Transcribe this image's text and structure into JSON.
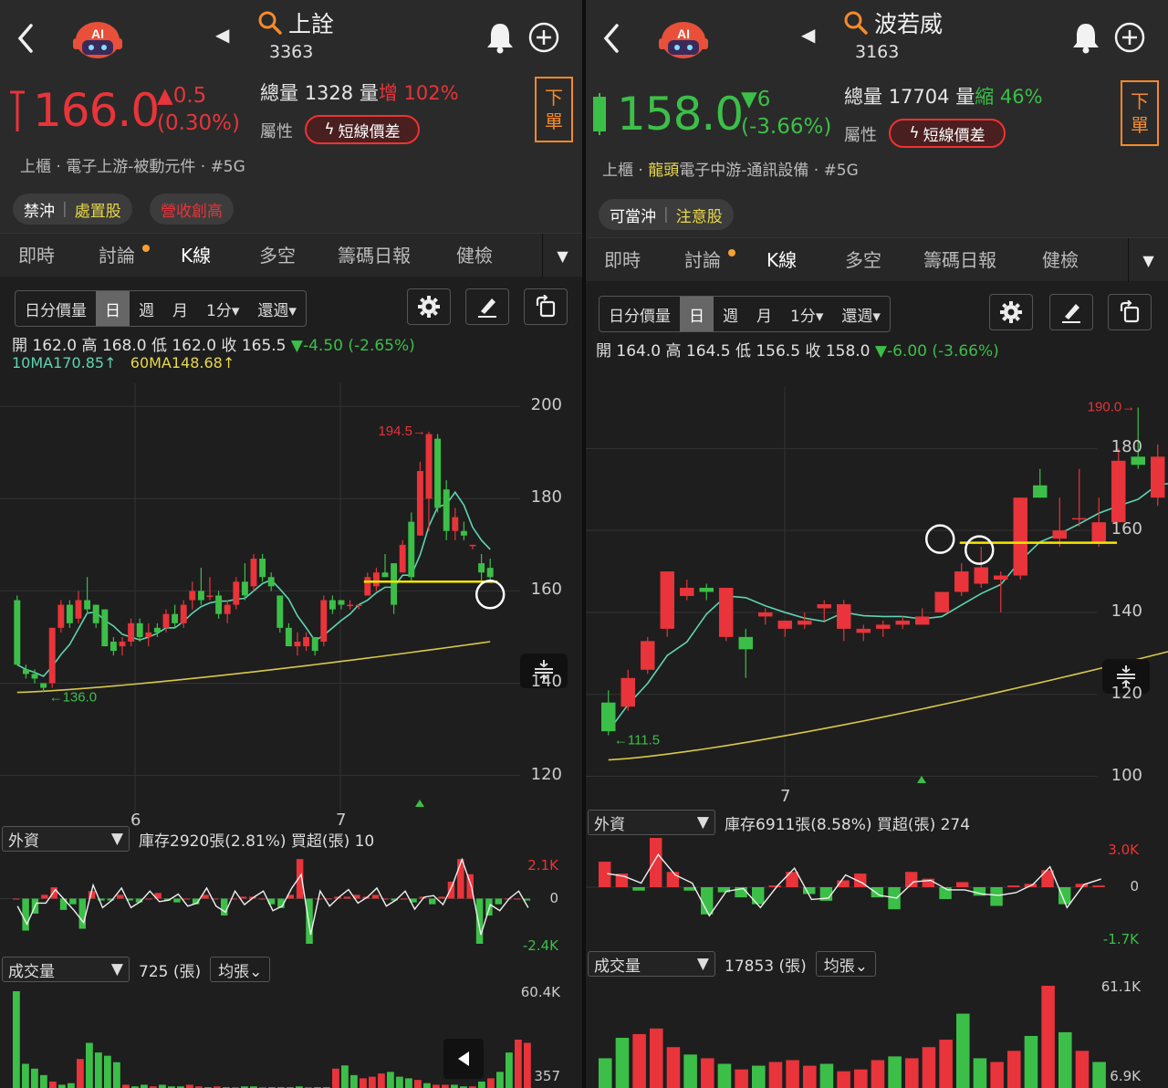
{
  "left": {
    "name": "上詮",
    "code": "3363",
    "price": "166.0",
    "change": "▲0.5",
    "change_pct": "(0.30%)",
    "total_label": "總量",
    "total_value": "1328",
    "vol_label": "量",
    "vol_dir": "增",
    "vol_pct": "102%",
    "attr_label": "屬性",
    "attr_pill": "短線價差",
    "order": [
      "下",
      "單"
    ],
    "industry_a": "上櫃 · ",
    "industry_b": "",
    "industry_c": "電子上游-被動元件 · #5G",
    "badge1a": "禁沖",
    "badge1b": "處置股",
    "badge2": "營收創高",
    "tabs": [
      "即時",
      "討論",
      "K線",
      "多空",
      "籌碼日報",
      "健檢"
    ],
    "periods": [
      "日分價量",
      "日",
      "週",
      "月",
      "1分▾",
      "還週▾"
    ],
    "ohlc_text": "開 162.0  高 168.0  低 162.0  收 165.5  ",
    "ohlc_chg": "▼-4.50 (-2.65%)",
    "ma10": "10MA170.85↑",
    "ma60": "60MA148.68↑",
    "yticks": [
      "200",
      "180",
      "160",
      "140",
      "120"
    ],
    "xticks": [
      "6",
      "7"
    ],
    "high_label": "194.5→",
    "low_label": "←136.0",
    "foreign_dd": "外資",
    "foreign_text": "庫存2920張(2.81%)  買超(張) 10",
    "foreign_ticks": [
      "2.1K",
      "0",
      "-2.4K"
    ],
    "vol_dd": "成交量",
    "vol_text": "725 (張)",
    "avg_btn": "均張⌄",
    "vol_ticks": [
      "60.4K",
      "357"
    ]
  },
  "right": {
    "name": "波若威",
    "code": "3163",
    "price": "158.0",
    "change": "▼6",
    "change_pct": "(-3.66%)",
    "total_label": "總量",
    "total_value": "17704",
    "vol_label": "量",
    "vol_dir": "縮",
    "vol_pct": "46%",
    "attr_label": "屬性",
    "attr_pill": "短線價差",
    "order": [
      "下",
      "單"
    ],
    "industry_a": "上櫃 · ",
    "industry_b": "龍頭",
    "industry_c": "電子中游-通訊設備 · #5G",
    "badge1a": "可當沖",
    "badge1b": "注意股",
    "badge2": "",
    "tabs": [
      "即時",
      "討論",
      "K線",
      "多空",
      "籌碼日報",
      "健檢"
    ],
    "periods": [
      "日分價量",
      "日",
      "週",
      "月",
      "1分▾",
      "還週▾"
    ],
    "ohlc_text": "開 164.0  高 164.5  低 156.5  收 158.0  ",
    "ohlc_chg": "▼-6.00 (-3.66%)",
    "yticks": [
      "180",
      "160",
      "140",
      "120",
      "100"
    ],
    "xticks": [
      "7"
    ],
    "high_label": "190.0→",
    "low_label": "←111.5",
    "foreign_dd": "外資",
    "foreign_text": "庫存6911張(8.58%)  買超(張) 274",
    "foreign_ticks": [
      "3.0K",
      "0",
      "-1.7K"
    ],
    "vol_dd": "成交量",
    "vol_text": "17853 (張)",
    "avg_btn": "均張⌄",
    "vol_ticks": [
      "61.1K",
      "6.9K"
    ]
  },
  "colors": {
    "up": "#e8343a",
    "down": "#3cbf48",
    "ma10": "#5fd4b0",
    "ma60": "#d9c84a",
    "support": "#f5e600",
    "accent": "#f58a2a"
  },
  "chart_data": [
    {
      "type": "candlestick",
      "title": "上詮 3363 日K",
      "y_range": [
        112,
        205
      ],
      "highlighted_level": 162,
      "candles": [
        {
          "o": 158,
          "h": 159,
          "l": 144,
          "c": 144
        },
        {
          "o": 143,
          "h": 144,
          "l": 141,
          "c": 142
        },
        {
          "o": 142,
          "h": 143,
          "l": 140,
          "c": 141
        },
        {
          "o": 140,
          "h": 140,
          "l": 138,
          "c": 139
        },
        {
          "o": 140,
          "h": 152,
          "l": 139,
          "c": 152
        },
        {
          "o": 152,
          "h": 158,
          "l": 151,
          "c": 157
        },
        {
          "o": 157,
          "h": 158,
          "l": 152,
          "c": 153
        },
        {
          "o": 154,
          "h": 160,
          "l": 153,
          "c": 158
        },
        {
          "o": 158,
          "h": 163,
          "l": 155,
          "c": 156
        },
        {
          "o": 157,
          "h": 157,
          "l": 152,
          "c": 153
        },
        {
          "o": 156,
          "h": 156,
          "l": 148,
          "c": 148
        },
        {
          "o": 149,
          "h": 150,
          "l": 146,
          "c": 147
        },
        {
          "o": 148,
          "h": 150,
          "l": 146,
          "c": 149
        },
        {
          "o": 149,
          "h": 154,
          "l": 148,
          "c": 153
        },
        {
          "o": 153,
          "h": 154,
          "l": 149,
          "c": 150
        },
        {
          "o": 150,
          "h": 153,
          "l": 148,
          "c": 151
        },
        {
          "o": 152,
          "h": 153,
          "l": 150,
          "c": 151
        },
        {
          "o": 152,
          "h": 156,
          "l": 151,
          "c": 155
        },
        {
          "o": 155,
          "h": 157,
          "l": 152,
          "c": 153
        },
        {
          "o": 153,
          "h": 158,
          "l": 152,
          "c": 157
        },
        {
          "o": 158,
          "h": 162,
          "l": 156,
          "c": 160
        },
        {
          "o": 160,
          "h": 165,
          "l": 157,
          "c": 158
        },
        {
          "o": 159,
          "h": 163,
          "l": 158,
          "c": 159
        },
        {
          "o": 159,
          "h": 160,
          "l": 154,
          "c": 155
        },
        {
          "o": 155,
          "h": 158,
          "l": 153,
          "c": 157
        },
        {
          "o": 157,
          "h": 163,
          "l": 156,
          "c": 162
        },
        {
          "o": 162,
          "h": 166,
          "l": 158,
          "c": 159
        },
        {
          "o": 161,
          "h": 168,
          "l": 160,
          "c": 167
        },
        {
          "o": 167,
          "h": 168,
          "l": 162,
          "c": 163
        },
        {
          "o": 163,
          "h": 164,
          "l": 160,
          "c": 161
        },
        {
          "o": 159,
          "h": 159,
          "l": 151,
          "c": 152
        },
        {
          "o": 152,
          "h": 153,
          "l": 148,
          "c": 148
        },
        {
          "o": 148,
          "h": 151,
          "l": 146,
          "c": 149
        },
        {
          "o": 148,
          "h": 151,
          "l": 147,
          "c": 150
        },
        {
          "o": 150,
          "h": 150,
          "l": 146,
          "c": 147
        },
        {
          "o": 149,
          "h": 159,
          "l": 148,
          "c": 158
        },
        {
          "o": 158,
          "h": 159,
          "l": 155,
          "c": 156
        },
        {
          "o": 158,
          "h": 158,
          "l": 156,
          "c": 157
        },
        {
          "o": 157,
          "h": 158,
          "l": 156,
          "c": 157
        },
        {
          "o": 157,
          "h": 157,
          "l": 156,
          "c": 157
        },
        {
          "o": 159,
          "h": 164,
          "l": 159,
          "c": 163
        },
        {
          "o": 161,
          "h": 165,
          "l": 160,
          "c": 164
        },
        {
          "o": 164,
          "h": 168,
          "l": 163,
          "c": 163
        },
        {
          "o": 166,
          "h": 166,
          "l": 155,
          "c": 157
        },
        {
          "o": 164,
          "h": 171,
          "l": 164,
          "c": 170
        },
        {
          "o": 175,
          "h": 177,
          "l": 162,
          "c": 163
        },
        {
          "o": 172,
          "h": 188,
          "l": 172,
          "c": 186
        },
        {
          "o": 180,
          "h": 194.5,
          "l": 173,
          "c": 194
        },
        {
          "o": 193,
          "h": 194,
          "l": 177,
          "c": 178
        },
        {
          "o": 182,
          "h": 184,
          "l": 171,
          "c": 173
        },
        {
          "o": 173,
          "h": 178,
          "l": 171,
          "c": 176
        },
        {
          "o": 173,
          "h": 175,
          "l": 171,
          "c": 172
        },
        {
          "o": 170,
          "h": 170,
          "l": 169,
          "c": 170
        },
        {
          "o": 166,
          "h": 168,
          "l": 162,
          "c": 164
        },
        {
          "o": 165,
          "h": 167,
          "l": 162,
          "c": 163
        }
      ],
      "foreign": [
        0,
        -1.7,
        -0.8,
        0.2,
        0.6,
        -0.6,
        -0.3,
        -1.6,
        0.4,
        -0.1,
        -0.1,
        0.2,
        -0.1,
        -0.2,
        0,
        0.3,
        -0.1,
        -0.2,
        0,
        -0.3,
        0.2,
        0,
        -0.9,
        0,
        0.1,
        0.1,
        0,
        -0.3,
        -0.5,
        0.2,
        2.1,
        -2.4,
        0,
        0,
        0.1,
        0.1,
        0.2,
        0.1,
        0.2,
        0,
        -0.1,
        0,
        -0.2,
        0.1,
        -0.3,
        0.1,
        0.9,
        2.1,
        1.3,
        -2.4,
        -0.9,
        -0.3,
        0,
        0,
        -0.1
      ],
      "volume": [
        60,
        15,
        12,
        8,
        4,
        2,
        3,
        18,
        28,
        22,
        20,
        16,
        2,
        1,
        2,
        1,
        2,
        1,
        1,
        2,
        1,
        0.5,
        1,
        0.5,
        0.5,
        1,
        1,
        0.5,
        0.5,
        0.5,
        0.5,
        1,
        0.5,
        0.5,
        0.5,
        12,
        14,
        8,
        6,
        7,
        9,
        10,
        7,
        6,
        5,
        3,
        2,
        2,
        2,
        1,
        1,
        4,
        6,
        10,
        22,
        30,
        28
      ]
    },
    {
      "type": "candlestick",
      "title": "波若威 3163 日K",
      "y_range": [
        95,
        200
      ],
      "highlighted_level": 157,
      "candles": [
        {
          "o": 118,
          "h": 121,
          "l": 110,
          "c": 111
        },
        {
          "o": 117,
          "h": 126,
          "l": 116,
          "c": 124
        },
        {
          "o": 126,
          "h": 134,
          "l": 125,
          "c": 133
        },
        {
          "o": 136,
          "h": 150,
          "l": 134,
          "c": 150
        },
        {
          "o": 144,
          "h": 148,
          "l": 143,
          "c": 146
        },
        {
          "o": 146,
          "h": 147,
          "l": 143,
          "c": 145
        },
        {
          "o": 134,
          "h": 146,
          "l": 133,
          "c": 146
        },
        {
          "o": 134,
          "h": 136,
          "l": 124,
          "c": 131
        },
        {
          "o": 139,
          "h": 141,
          "l": 137,
          "c": 140
        },
        {
          "o": 136,
          "h": 138,
          "l": 134,
          "c": 138
        },
        {
          "o": 137,
          "h": 140,
          "l": 136,
          "c": 138
        },
        {
          "o": 141,
          "h": 143,
          "l": 138,
          "c": 142
        },
        {
          "o": 136,
          "h": 143,
          "l": 133,
          "c": 142
        },
        {
          "o": 135,
          "h": 137,
          "l": 133,
          "c": 136
        },
        {
          "o": 136,
          "h": 138,
          "l": 134,
          "c": 137
        },
        {
          "o": 137,
          "h": 139,
          "l": 136,
          "c": 138
        },
        {
          "o": 137,
          "h": 141,
          "l": 137,
          "c": 139
        },
        {
          "o": 140,
          "h": 144,
          "l": 140,
          "c": 145
        },
        {
          "o": 145,
          "h": 152,
          "l": 144,
          "c": 150
        },
        {
          "o": 147,
          "h": 156,
          "l": 146,
          "c": 151
        },
        {
          "o": 148,
          "h": 150,
          "l": 140,
          "c": 149
        },
        {
          "o": 149,
          "h": 168,
          "l": 148,
          "c": 168
        },
        {
          "o": 171,
          "h": 175,
          "l": 168,
          "c": 168
        },
        {
          "o": 158,
          "h": 168,
          "l": 156,
          "c": 160
        },
        {
          "o": 163,
          "h": 175,
          "l": 161,
          "c": 163
        },
        {
          "o": 157,
          "h": 168,
          "l": 156,
          "c": 162
        },
        {
          "o": 162,
          "h": 180,
          "l": 162,
          "c": 177
        },
        {
          "o": 178,
          "h": 190,
          "l": 175,
          "c": 176
        },
        {
          "o": 168,
          "h": 181,
          "l": 166,
          "c": 178
        },
        {
          "o": 160,
          "h": 166,
          "l": 158,
          "c": 165
        }
      ],
      "foreign": [
        1.5,
        0.8,
        -0.2,
        2.9,
        0.9,
        -0.2,
        -1.6,
        -0.3,
        -0.6,
        -1.0,
        0.1,
        0.9,
        -0.4,
        -0.8,
        0.4,
        0.8,
        -0.6,
        -1.3,
        0.9,
        0.5,
        -0.7,
        0.3,
        -0.5,
        -1.1,
        0.1,
        0.2,
        1.0,
        -1.0,
        0.2,
        0.1
      ],
      "volume": [
        16,
        27,
        29,
        32,
        22,
        18,
        16,
        13,
        10,
        12,
        14,
        15,
        12,
        13,
        9,
        10,
        15,
        17,
        16,
        22,
        26,
        40,
        16,
        14,
        20,
        28,
        55,
        30,
        20,
        14
      ]
    }
  ]
}
